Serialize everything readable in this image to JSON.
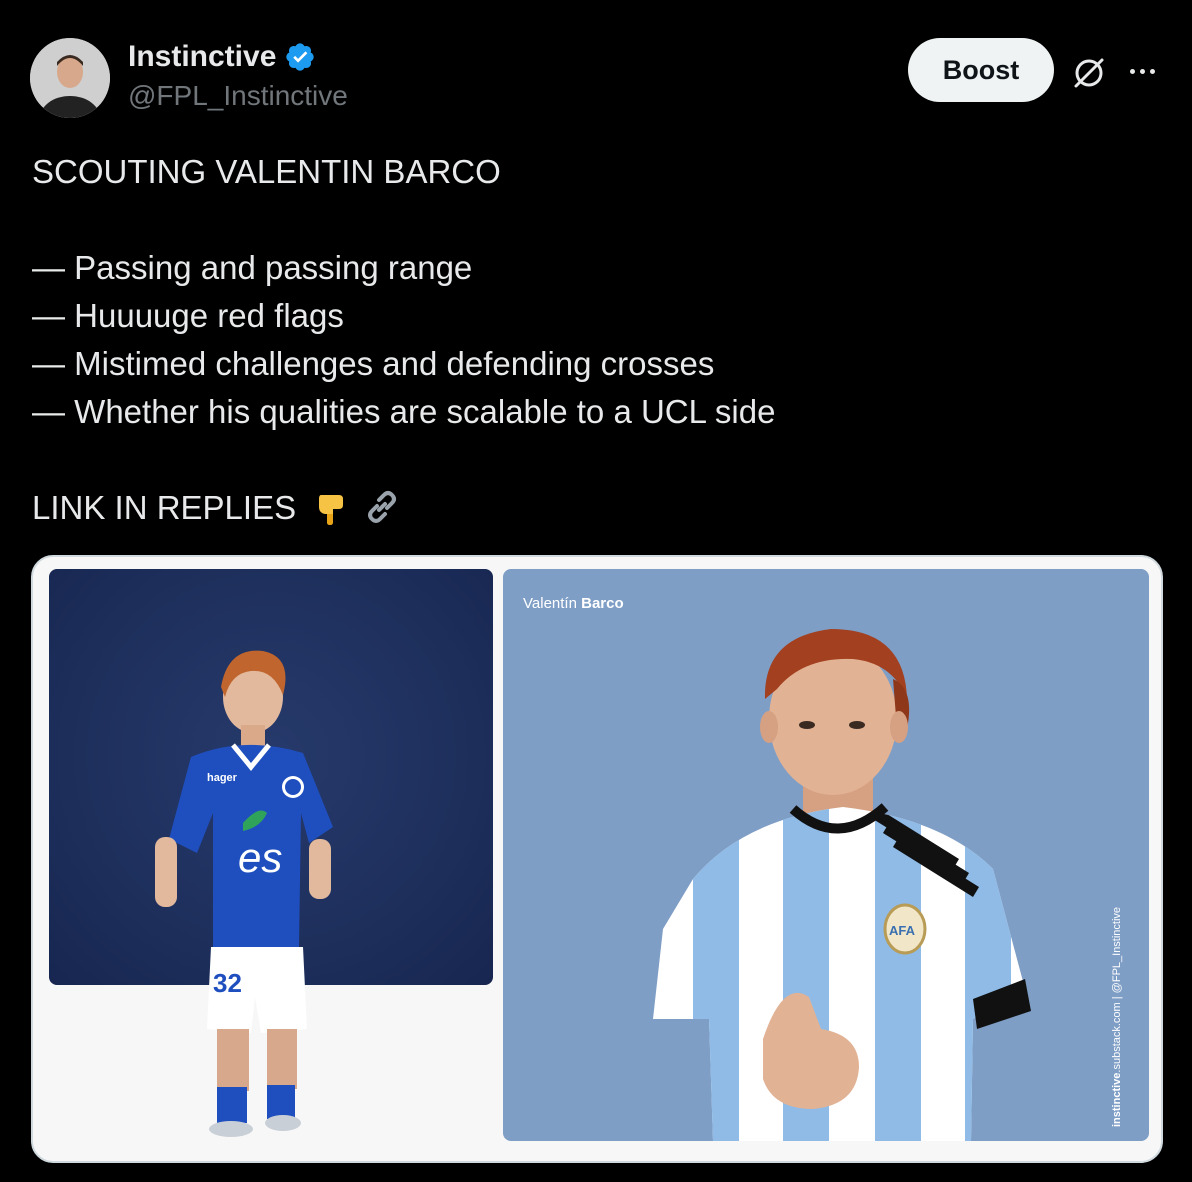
{
  "author": {
    "display_name": "Instinctive",
    "handle": "@FPL_Instinctive",
    "verified": true
  },
  "actions": {
    "boost_label": "Boost",
    "grok_icon": "grok-icon",
    "more_icon": "more-icon"
  },
  "tweet": {
    "title": "SCOUTING VALENTIN BARCO",
    "bullets": [
      "— Passing and passing range",
      "— Huuuuge red flags",
      "— Mistimed challenges and defending crosses",
      "— Whether his qualities are scalable to a UCL side"
    ],
    "cta": "LINK IN REPLIES",
    "cta_emoji": [
      "pointing-down-hand",
      "link-icon"
    ]
  },
  "media": {
    "panel_first_name": "Valentín",
    "panel_last_name": "Barco",
    "credit_bold": "instinctive",
    "credit_rest": ".substack.com | @FPL_Instinctive",
    "left_kit_number": "32",
    "left_kit_sponsor": "es",
    "left_kit_brand": "hager",
    "right_badge": "AFA"
  },
  "colors": {
    "background": "#000000",
    "text": "#e7e9ea",
    "muted": "#71767b",
    "verified": "#1d9bf0",
    "left_panel": "#1e2f5c",
    "right_panel": "#7f9ec6"
  }
}
